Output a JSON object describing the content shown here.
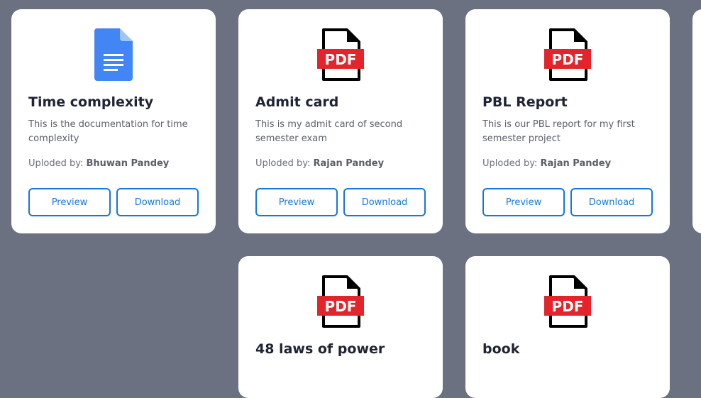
{
  "uploaded_prefix": "Uploded by:",
  "preview_label": "Preview",
  "download_label": "Download",
  "cards": [
    {
      "icon": "google-docs-icon",
      "title": "Time complexity",
      "description": "This is the documentation for time complexity",
      "uploader": "Bhuwan Pandey"
    },
    {
      "icon": "pdf-icon",
      "title": "Admit card",
      "description": "This is my admit card of second semester exam",
      "uploader": "Rajan Pandey"
    },
    {
      "icon": "pdf-icon",
      "title": "PBL Report",
      "description": "This is our PBL report for my first semester project",
      "uploader": "Rajan Pandey"
    },
    {
      "icon": "pdf-icon",
      "title": "48 laws of power"
    },
    {
      "icon": "pdf-icon",
      "title": "book"
    }
  ],
  "colors": {
    "background": "#6b7180",
    "accent": "#1877d6",
    "pdf_red": "#e3242b",
    "doc_blue": "#4285f4"
  }
}
